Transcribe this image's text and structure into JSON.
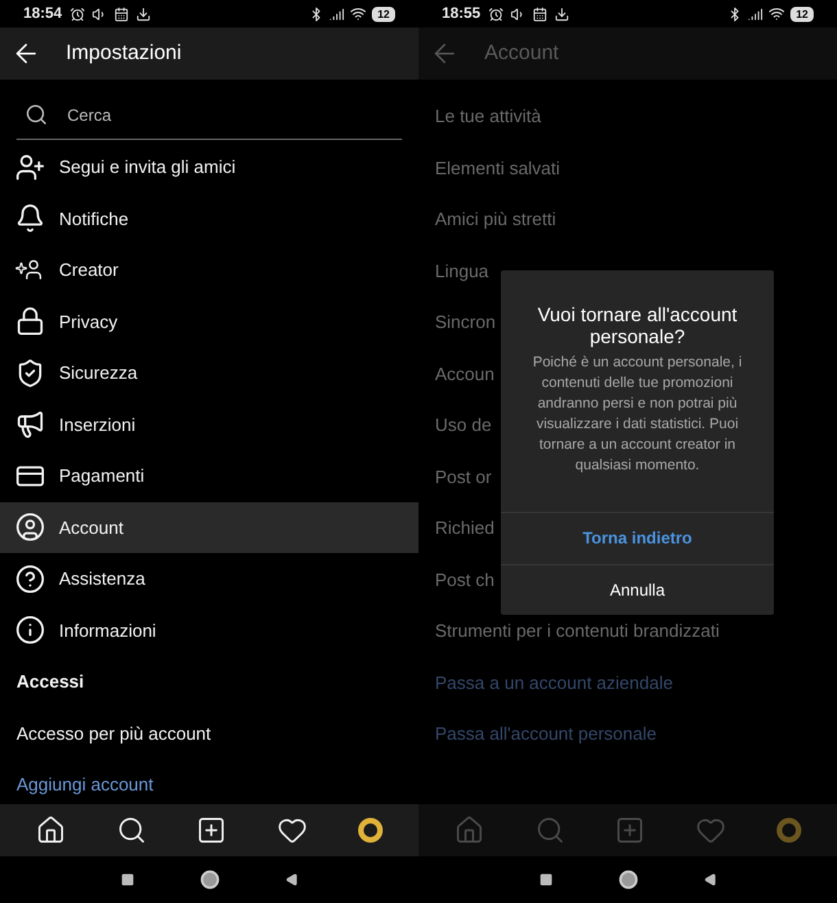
{
  "screens": [
    {
      "status_bar": {
        "time": "18:54",
        "battery": "12"
      },
      "header": {
        "title": "Impostazioni"
      },
      "search": {
        "placeholder": "Cerca"
      },
      "items": [
        {
          "kind": "icon",
          "label": "Segui e invita gli amici",
          "selected": false
        },
        {
          "kind": "icon",
          "label": "Notifiche",
          "selected": false
        },
        {
          "kind": "icon",
          "label": "Creator",
          "selected": false
        },
        {
          "kind": "icon",
          "label": "Privacy",
          "selected": false
        },
        {
          "kind": "icon",
          "label": "Sicurezza",
          "selected": false
        },
        {
          "kind": "icon",
          "label": "Inserzioni",
          "selected": false
        },
        {
          "kind": "icon",
          "label": "Pagamenti",
          "selected": false
        },
        {
          "kind": "icon",
          "label": "Account",
          "selected": true
        },
        {
          "kind": "icon",
          "label": "Assistenza",
          "selected": false
        },
        {
          "kind": "icon",
          "label": "Informazioni",
          "selected": false
        },
        {
          "kind": "section",
          "label": "Accessi"
        },
        {
          "kind": "plain",
          "label": "Accesso per più account"
        },
        {
          "kind": "link",
          "label": "Aggiungi account"
        }
      ]
    },
    {
      "status_bar": {
        "time": "18:55",
        "battery": "12"
      },
      "header": {
        "title": "Account"
      },
      "items": [
        {
          "kind": "plain",
          "label": "Le tue attività"
        },
        {
          "kind": "plain",
          "label": "Elementi salvati"
        },
        {
          "kind": "plain",
          "label": "Amici più stretti"
        },
        {
          "kind": "plain",
          "label": "Lingua"
        },
        {
          "kind": "plain",
          "label": "Sincron"
        },
        {
          "kind": "plain",
          "label": "Accoun"
        },
        {
          "kind": "plain",
          "label": "Uso de"
        },
        {
          "kind": "plain",
          "label": "Post or"
        },
        {
          "kind": "plain",
          "label": "Richied"
        },
        {
          "kind": "plain",
          "label": "Post ch"
        },
        {
          "kind": "plain",
          "label": "Strumenti per i contenuti brandizzati"
        },
        {
          "kind": "link",
          "label": "Passa a un account aziendale"
        },
        {
          "kind": "link",
          "label": "Passa all'account personale"
        }
      ],
      "dialog": {
        "title": "Vuoi tornare all'account personale?",
        "message": "Poiché è un account personale, i contenuti delle tue promozioni andranno persi e non potrai più visualizzare i dati statistici. Puoi tornare a un account creator in qualsiasi momento.",
        "buttons": [
          {
            "kind": "primary",
            "label": "Torna indietro"
          },
          {
            "kind": "secondary",
            "label": "Annulla"
          }
        ]
      }
    }
  ]
}
